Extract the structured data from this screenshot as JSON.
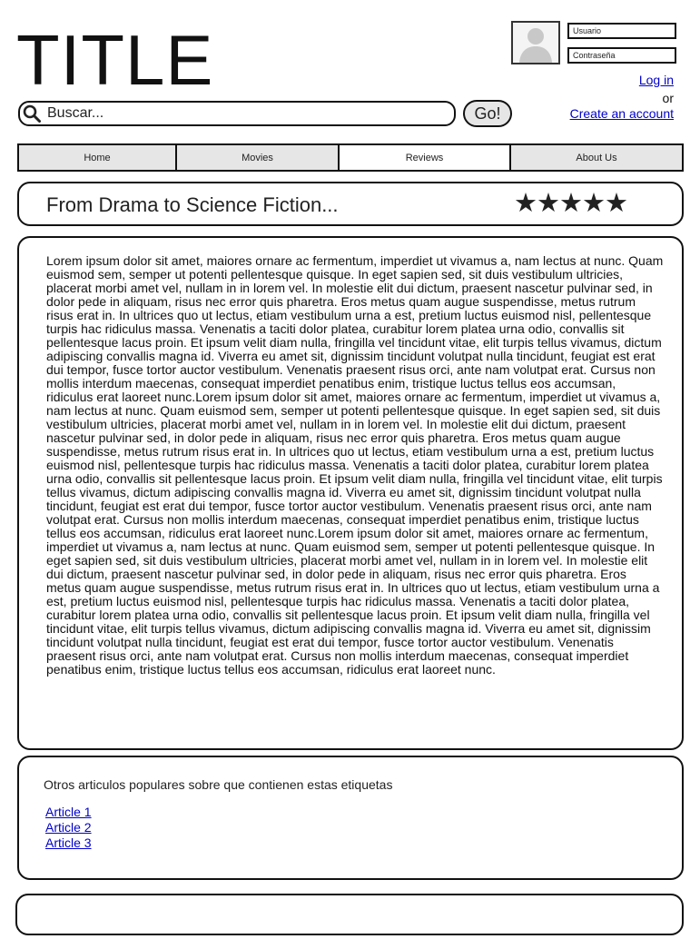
{
  "site": {
    "title": "TITLE"
  },
  "search": {
    "placeholder": "Buscar...",
    "button_label": "Go!"
  },
  "login": {
    "username_placeholder": "Usuario",
    "password_placeholder": "Contraseña",
    "login_label": "Log in",
    "or_label": "or",
    "create_account_label": "Create an account"
  },
  "nav": {
    "tabs": [
      {
        "label": "Home"
      },
      {
        "label": "Movies"
      },
      {
        "label": "Reviews"
      },
      {
        "label": "About Us"
      }
    ]
  },
  "article": {
    "heading": "From Drama to Science Fiction...",
    "rating_stars": "★★★★★",
    "rating_value": 5,
    "body": "Lorem ipsum dolor sit amet, maiores ornare ac fermentum, imperdiet ut vivamus a, nam lectus at nunc. Quam euismod sem, semper ut potenti pellentesque quisque. In eget sapien sed, sit duis vestibulum ultricies, placerat morbi amet vel, nullam in in lorem vel. In molestie elit dui dictum, praesent nascetur pulvinar sed, in dolor pede in aliquam, risus nec error quis pharetra. Eros metus quam augue suspendisse, metus rutrum risus erat in.  In ultrices quo ut lectus, etiam vestibulum urna a est, pretium luctus euismod nisl, pellentesque turpis hac ridiculus massa. Venenatis a taciti dolor platea, curabitur lorem platea urna odio, convallis sit pellentesque lacus proin. Et ipsum velit diam nulla, fringilla vel tincidunt vitae, elit turpis tellus vivamus, dictum adipiscing convallis magna id. Viverra eu amet sit, dignissim tincidunt volutpat nulla tincidunt, feugiat est erat dui tempor, fusce tortor auctor vestibulum. Venenatis praesent risus orci, ante nam volutpat erat. Cursus non mollis interdum maecenas, consequat imperdiet penatibus enim, tristique luctus tellus eos accumsan, ridiculus erat laoreet nunc.Lorem ipsum dolor sit amet, maiores ornare ac fermentum, imperdiet ut vivamus a, nam lectus at nunc. Quam euismod sem, semper ut potenti pellentesque quisque. In eget sapien sed, sit duis vestibulum ultricies, placerat morbi amet vel, nullam in in lorem vel. In molestie elit dui dictum, praesent nascetur pulvinar sed, in dolor pede in aliquam, risus nec error quis pharetra. Eros metus quam augue suspendisse, metus rutrum risus erat in.  In ultrices quo ut lectus, etiam vestibulum urna a est, pretium luctus euismod nisl, pellentesque turpis hac ridiculus massa. Venenatis a taciti dolor platea, curabitur lorem platea urna odio, convallis sit pellentesque lacus proin. Et ipsum velit diam nulla, fringilla vel tincidunt vitae, elit turpis tellus vivamus, dictum adipiscing convallis magna id. Viverra eu amet sit, dignissim tincidunt volutpat nulla tincidunt, feugiat est erat dui tempor, fusce tortor auctor vestibulum. Venenatis praesent risus orci, ante nam volutpat erat. Cursus non mollis interdum maecenas, consequat imperdiet penatibus enim, tristique luctus tellus eos accumsan, ridiculus erat laoreet nunc.Lorem ipsum dolor sit amet, maiores ornare ac fermentum, imperdiet ut vivamus a, nam lectus at nunc. Quam euismod sem, semper ut potenti pellentesque quisque. In eget sapien sed, sit duis vestibulum ultricies, placerat morbi amet vel, nullam in in lorem vel. In molestie elit dui dictum, praesent nascetur pulvinar sed, in dolor pede in aliquam, risus nec error quis pharetra. Eros metus quam augue suspendisse, metus rutrum risus erat in.  In ultrices quo ut lectus, etiam vestibulum urna a est, pretium luctus euismod nisl, pellentesque turpis hac ridiculus massa. Venenatis a taciti dolor platea, curabitur lorem platea urna odio, convallis sit pellentesque lacus proin. Et ipsum velit diam nulla, fringilla vel tincidunt vitae, elit turpis tellus vivamus, dictum adipiscing convallis magna id. Viverra eu amet sit, dignissim tincidunt volutpat nulla tincidunt, feugiat est erat dui tempor, fusce tortor auctor vestibulum. Venenatis praesent risus orci, ante nam volutpat erat. Cursus non mollis interdum maecenas, consequat imperdiet penatibus enim, tristique luctus tellus eos accumsan, ridiculus erat laoreet nunc."
  },
  "related": {
    "heading": "Otros articulos populares sobre que contienen estas etiquetas",
    "articles": [
      {
        "label": "Article 1"
      },
      {
        "label": "Article 2"
      },
      {
        "label": "Article 3"
      }
    ]
  },
  "icons": {
    "search": "search-icon",
    "avatar": "user-silhouette-icon",
    "rating": "star-icon"
  },
  "colors": {
    "link": "#0000cc",
    "tab_inactive": "#e6e6e6",
    "tab_active": "#ffffff",
    "border": "#111111"
  }
}
